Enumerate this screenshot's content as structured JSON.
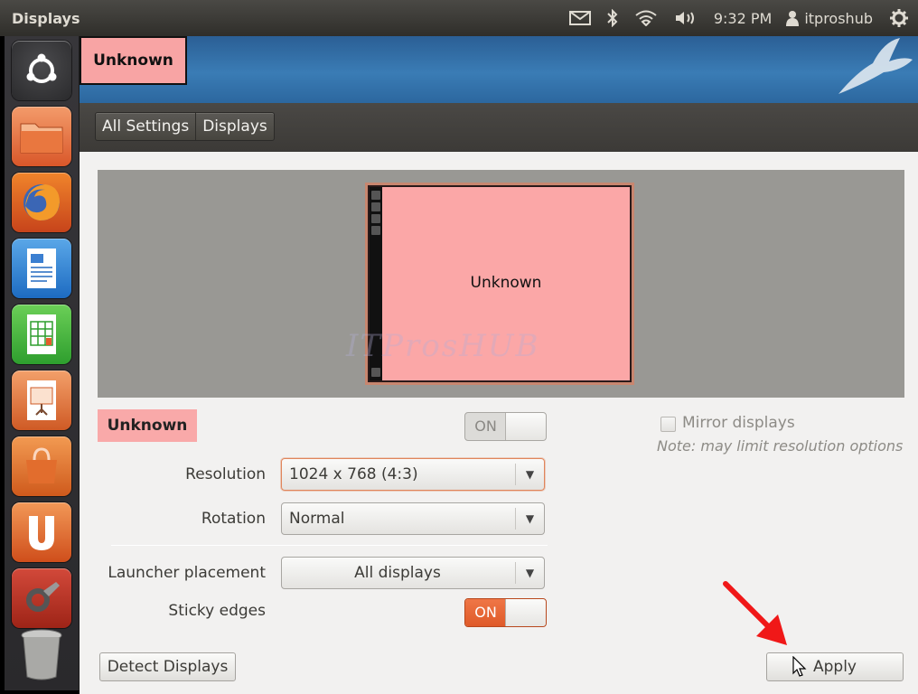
{
  "window": {
    "title": "Displays"
  },
  "panel": {
    "clock": "9:32 PM",
    "user": "itproshub",
    "icons": [
      "mail-icon",
      "bluetooth-icon",
      "wifi-icon",
      "volume-icon",
      "user-icon",
      "power-gear-icon"
    ]
  },
  "launcher": {
    "items": [
      "dash-home",
      "files",
      "firefox",
      "libreoffice-writer",
      "libreoffice-calc",
      "libreoffice-impress",
      "software-center",
      "ubuntu-one",
      "system-settings",
      "trash"
    ]
  },
  "header": {
    "display_label": "Unknown"
  },
  "breadcrumb": {
    "items": [
      "All Settings",
      "Displays"
    ]
  },
  "preview": {
    "monitor_label": "Unknown",
    "watermark": "ITProsHUB"
  },
  "display": {
    "name": "Unknown",
    "power_switch": "ON",
    "resolution_label": "Resolution",
    "resolution_value": "1024 x 768 (4:3)",
    "rotation_label": "Rotation",
    "rotation_value": "Normal",
    "launcher_label": "Launcher placement",
    "launcher_value": "All displays",
    "sticky_label": "Sticky edges",
    "sticky_switch": "ON"
  },
  "mirror": {
    "label": "Mirror displays",
    "checked": false,
    "note": "Note: may limit resolution options"
  },
  "buttons": {
    "detect": "Detect Displays",
    "apply": "Apply"
  },
  "colors": {
    "accent": "#df5a29",
    "display_highlight": "#f9a9a9",
    "annotation_arrow": "#f01818"
  }
}
